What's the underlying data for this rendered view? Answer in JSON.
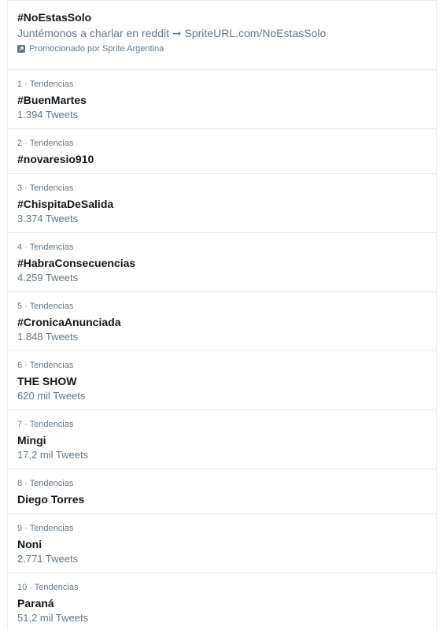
{
  "promo": {
    "hashtag": "#NoEstasSolo",
    "description": "Juntémonos a charlar en reddit ➞ SpriteURL.com/NoEstasSolo",
    "promoted_by": "Promocionado por Sprite Argentina",
    "icon": "promoted-icon"
  },
  "trends": [
    {
      "meta": "1 · Tendencias",
      "name": "#BuenMartes",
      "count": "1.394 Tweets"
    },
    {
      "meta": "2 · Tendencias",
      "name": "#novaresio910",
      "count": ""
    },
    {
      "meta": "3 · Tendencias",
      "name": "#ChispitaDeSalida",
      "count": "3.374 Tweets"
    },
    {
      "meta": "4 · Tendencias",
      "name": "#HabraConsecuencias",
      "count": "4.259 Tweets"
    },
    {
      "meta": "5 · Tendencias",
      "name": "#CronicaAnunciada",
      "count": "1.848 Tweets"
    },
    {
      "meta": "6 · Tendencias",
      "name": "THE SHOW",
      "count": "620 mil Tweets"
    },
    {
      "meta": "7 · Tendencias",
      "name": "Mingi",
      "count": "17,2 mil Tweets"
    },
    {
      "meta": "8 · Tendencias",
      "name": "Diego Torres",
      "count": ""
    },
    {
      "meta": "9 · Tendencias",
      "name": "Noni",
      "count": "2.771 Tweets"
    },
    {
      "meta": "10 · Tendencias",
      "name": "Paraná",
      "count": "51,2 mil Tweets"
    }
  ]
}
